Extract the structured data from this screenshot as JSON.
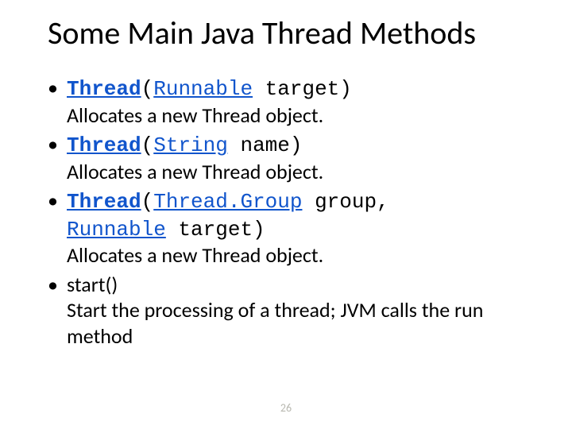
{
  "title": "Some Main Java Thread Methods",
  "items": [
    {
      "sig_class": "Thread",
      "sig_open": "(",
      "sig_param_type": "Runnable",
      "sig_param_rest": " target)",
      "desc": "Allocates a new Thread object."
    },
    {
      "sig_class": "Thread",
      "sig_open": "(",
      "sig_param_type": "String",
      "sig_param_rest": " name)",
      "desc": "Allocates a new Thread object."
    },
    {
      "sig_class": "Thread",
      "sig_open": "(",
      "sig_param_type": "Thread.Group",
      "sig_param_rest": " group, ",
      "sig_param_type2": "Runnable",
      "sig_param_rest2": " target)",
      "desc": "Allocates a new Thread object."
    },
    {
      "plain_sig": "start()",
      "desc": "Start the processing of a thread; JVM calls the run method"
    }
  ],
  "page_number": "26"
}
